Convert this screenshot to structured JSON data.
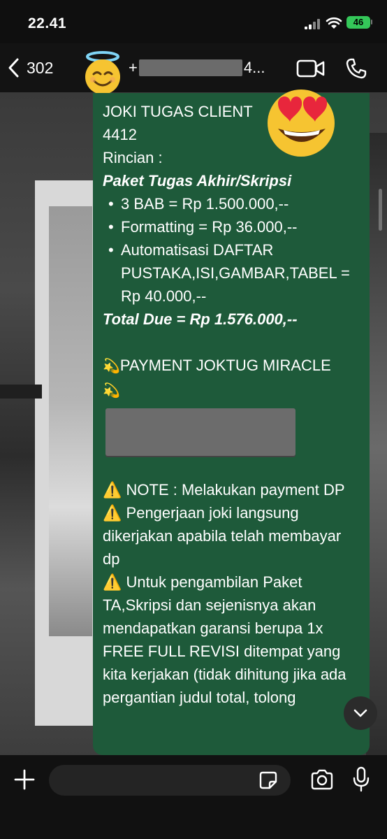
{
  "status_bar": {
    "time": "22.41",
    "battery": "46"
  },
  "header": {
    "back_count": "302",
    "contact_name_suffix": "4...",
    "contact_name_prefix": "+",
    "avatar_icon": "smiling-face-with-halo-icon"
  },
  "decorations": {
    "overlay_emoji": "smiling-face-with-heart-eyes-icon"
  },
  "message": {
    "title": "JOKI TUGAS CLIENT",
    "client_no": "4412",
    "rincian_label": "Rincian :",
    "package": "Paket Tugas Akhir/Skripsi",
    "items": [
      "3 BAB = Rp 1.500.000,--",
      "Formatting = Rp 36.000,--",
      "Automatisasi DAFTAR PUSTAKA,ISI,GAMBAR,TABEL = Rp 40.000,--"
    ],
    "total": "Total Due = Rp 1.576.000,--",
    "payment_heading": "PAYMENT JOKTUG MIRACLE",
    "notes": [
      "NOTE : Melakukan payment DP",
      "Pengerjaan joki langsung dikerjakan apabila telah membayar dp",
      "Untuk pengambilan Paket TA,Skripsi dan sejenisnya akan mendapatkan garansi berupa 1x FREE FULL REVISI ditempat yang kita kerjakan (tidak dihitung jika ada pergantian judul total, tolong"
    ]
  },
  "composer": {
    "placeholder": ""
  },
  "colors": {
    "bubble": "#1e5a3a",
    "battery": "#34c759",
    "warning": "#f5c518"
  }
}
